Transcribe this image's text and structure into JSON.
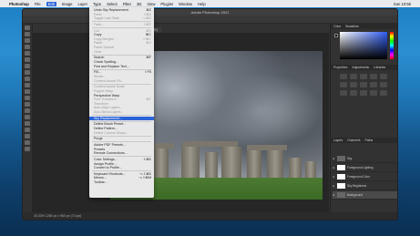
{
  "menubar": {
    "apple": "",
    "app": "Photoshop",
    "items": [
      "File",
      "Edit",
      "Image",
      "Layer",
      "Type",
      "Select",
      "Filter",
      "3D",
      "View",
      "Plugins",
      "Window",
      "Help"
    ],
    "active": "Edit",
    "right": [
      "Sun 10:56"
    ]
  },
  "window": {
    "title": "Adobe Photoshop 2021",
    "doc_tab": "Background_1234.tif @ 33.3% (RGB/8*)",
    "status": "33.33%   1280 px x 960 px (72 ppi)"
  },
  "edit_menu": [
    {
      "label": "Undo Sky Replacement",
      "shortcut": "⌘Z",
      "disabled": false
    },
    {
      "label": "Redo",
      "shortcut": "⇧⌘Z",
      "disabled": true
    },
    {
      "label": "Toggle Last State",
      "shortcut": "⌥⌘Z",
      "disabled": true
    },
    {
      "sep": true
    },
    {
      "label": "Fade...",
      "shortcut": "⇧⌘F",
      "disabled": true
    },
    {
      "sep": true
    },
    {
      "label": "Cut",
      "shortcut": "⌘X",
      "disabled": true
    },
    {
      "label": "Copy",
      "shortcut": "⌘C",
      "disabled": false
    },
    {
      "label": "Copy Merged",
      "shortcut": "⇧⌘C",
      "disabled": true
    },
    {
      "label": "Paste",
      "shortcut": "⌘V",
      "disabled": true
    },
    {
      "label": "Paste Special",
      "shortcut": "",
      "disabled": true
    },
    {
      "label": "Clear",
      "shortcut": "",
      "disabled": true
    },
    {
      "sep": true
    },
    {
      "label": "Search",
      "shortcut": "⌘F",
      "disabled": false
    },
    {
      "label": "Check Spelling...",
      "shortcut": "",
      "disabled": false
    },
    {
      "label": "Find and Replace Text...",
      "shortcut": "",
      "disabled": false
    },
    {
      "sep": true
    },
    {
      "label": "Fill...",
      "shortcut": "⇧F5",
      "disabled": false
    },
    {
      "label": "Stroke...",
      "shortcut": "",
      "disabled": true
    },
    {
      "label": "Content-Aware Fill...",
      "shortcut": "",
      "disabled": true
    },
    {
      "sep": true
    },
    {
      "label": "Content-Aware Scale",
      "shortcut": "",
      "disabled": true
    },
    {
      "label": "Puppet Warp",
      "shortcut": "",
      "disabled": true
    },
    {
      "label": "Perspective Warp",
      "shortcut": "",
      "disabled": false
    },
    {
      "label": "Free Transform",
      "shortcut": "⌘T",
      "disabled": true
    },
    {
      "label": "Transform",
      "shortcut": "",
      "disabled": true
    },
    {
      "label": "Auto-Align Layers...",
      "shortcut": "",
      "disabled": true
    },
    {
      "label": "Auto-Blend Layers...",
      "shortcut": "",
      "disabled": true
    },
    {
      "sep": true
    },
    {
      "label": "Sky Replacement...",
      "shortcut": "",
      "disabled": false,
      "highlight": true
    },
    {
      "sep": true
    },
    {
      "label": "Define Brush Preset...",
      "shortcut": "",
      "disabled": false
    },
    {
      "label": "Define Pattern...",
      "shortcut": "",
      "disabled": false
    },
    {
      "label": "Define Custom Shape...",
      "shortcut": "",
      "disabled": true
    },
    {
      "sep": true
    },
    {
      "label": "Purge",
      "shortcut": "",
      "disabled": false
    },
    {
      "sep": true
    },
    {
      "label": "Adobe PDF Presets...",
      "shortcut": "",
      "disabled": false
    },
    {
      "label": "Presets",
      "shortcut": "",
      "disabled": false
    },
    {
      "label": "Remote Connections...",
      "shortcut": "",
      "disabled": false
    },
    {
      "sep": true
    },
    {
      "label": "Color Settings...",
      "shortcut": "⇧⌘K",
      "disabled": false
    },
    {
      "label": "Assign Profile...",
      "shortcut": "",
      "disabled": false
    },
    {
      "label": "Convert to Profile...",
      "shortcut": "",
      "disabled": false
    },
    {
      "sep": true
    },
    {
      "label": "Keyboard Shortcuts...",
      "shortcut": "⌥⇧⌘K",
      "disabled": false
    },
    {
      "label": "Menus...",
      "shortcut": "⌥⇧⌘M",
      "disabled": false
    },
    {
      "label": "Toolbar...",
      "shortcut": "",
      "disabled": false
    }
  ],
  "panels": {
    "color_tabs": [
      "Color",
      "Swatches"
    ],
    "adj_tabs": [
      "Properties",
      "Adjustments",
      "Libraries"
    ],
    "layers_tabs": [
      "Layers",
      "Channels",
      "Paths"
    ],
    "layers": [
      {
        "name": "Sky",
        "type": "group"
      },
      {
        "name": "Foreground Lighting",
        "type": "adjust"
      },
      {
        "name": "Foreground Color",
        "type": "adjust"
      },
      {
        "name": "Sky Brightness",
        "type": "adjust"
      },
      {
        "name": "Background",
        "type": "image"
      }
    ]
  }
}
